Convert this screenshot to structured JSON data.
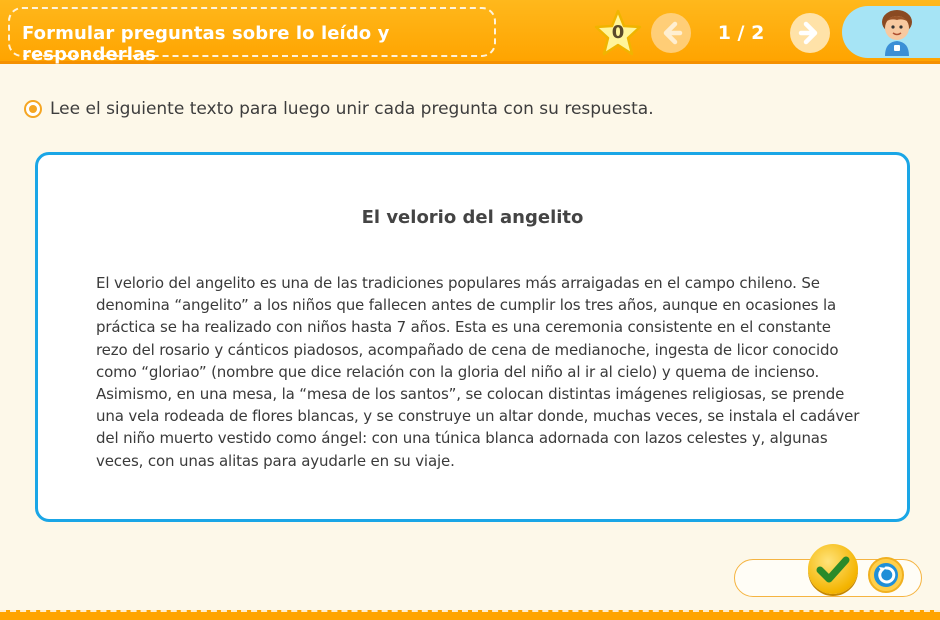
{
  "header": {
    "title": "Formular preguntas sobre lo leído y responderlas",
    "stars_count": "0",
    "page_indicator": "1 / 2"
  },
  "instruction": {
    "text": "Lee el siguiente texto para luego unir cada pregunta con su respuesta."
  },
  "reading": {
    "title": "El velorio del angelito",
    "body": "El velorio del angelito es una de las tradiciones populares más arraigadas en el campo chileno. Se denomina “angelito” a los niños que fallecen antes de cumplir los tres años, aunque en ocasiones la práctica se ha realizado con niños hasta 7 años. Esta es una ceremonia consistente en el constante rezo del rosario y cánticos piadosos, acompañado de cena de medianoche, ingesta de licor conocido como “gloriao” (nombre que dice relación con la gloria del niño al ir al cielo) y quema de incienso. Asimismo, en una mesa, la “mesa de los santos”, se colocan distintas imágenes religiosas, se prende una vela rodeada de flores blancas, y se construye un altar donde, muchas veces, se instala el cadáver del niño muerto vestido como ángel: con una túnica blanca adornada con lazos celestes y, algunas veces, con unas alitas para ayudarle en su viaje."
  },
  "icons": {
    "star": "star-icon",
    "prev": "arrow-left-icon",
    "next": "arrow-right-icon",
    "avatar": "avatar-icon",
    "check": "check-icon",
    "reset": "reset-icon"
  },
  "colors": {
    "header": "#ffa400",
    "card_border": "#1aa6e6",
    "accent": "#f5a623",
    "background": "#fdf8e9"
  }
}
